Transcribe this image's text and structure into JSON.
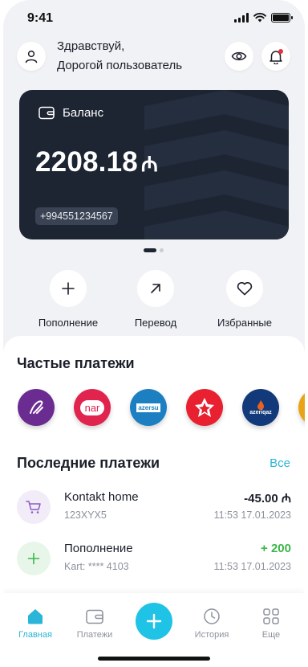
{
  "status_bar": {
    "time": "9:41"
  },
  "header": {
    "greeting_line1": "Здравствуй,",
    "greeting_line2": "Дорогой пользователь"
  },
  "balance_card": {
    "label": "Баланс",
    "amount": "2208.18",
    "currency": "₼",
    "phone": "+994551234567",
    "pager": {
      "pages": 2,
      "active": 1
    }
  },
  "actions": [
    {
      "label": "Пополнение",
      "icon": "plus-icon"
    },
    {
      "label": "Перевод",
      "icon": "arrow-up-right-icon"
    },
    {
      "label": "Избранные",
      "icon": "heart-icon"
    }
  ],
  "frequent_payments": {
    "title": "Частые платежи",
    "logos": [
      {
        "icon": "provider-logo-purple",
        "color": "#6a2c91"
      },
      {
        "icon": "provider-logo-nar",
        "text": "nar",
        "color": "#e0244e"
      },
      {
        "icon": "provider-logo-azersu",
        "text": "azersu",
        "color": "#1c7fc2"
      },
      {
        "icon": "provider-logo-red",
        "color": "#e8202f"
      },
      {
        "icon": "provider-logo-azeriqaz",
        "text": "azeriqaz",
        "color": "#123a7a"
      },
      {
        "icon": "provider-logo-partial",
        "color": "#e8a317"
      }
    ]
  },
  "recent_payments": {
    "title": "Последние платежи",
    "see_all": "Все",
    "items": [
      {
        "name": "Kontakt home",
        "sub": "123XYX5",
        "amount": "-45.00 ₼",
        "date": "11:53 17.01.2023",
        "icon": "cart-icon",
        "amount_color": "#1b1f2a"
      },
      {
        "name": "Пополнение",
        "sub": "Kart: **** 4103",
        "amount": "+ 200",
        "date": "11:53 17.01.2023",
        "icon": "plus-icon",
        "amount_color": "#3bb54a"
      }
    ]
  },
  "bottom_nav": [
    {
      "label": "Главная",
      "icon": "home-icon",
      "active": true
    },
    {
      "label": "Платежи",
      "icon": "wallet-icon",
      "active": false
    },
    {
      "label": "",
      "icon": "add-icon",
      "active": false
    },
    {
      "label": "История",
      "icon": "clock-icon",
      "active": false
    },
    {
      "label": "Еще",
      "icon": "grid-icon",
      "active": false
    }
  ],
  "colors": {
    "accent": "#1fc3e6",
    "card_background": "#1d2533",
    "positive": "#3bb54a"
  }
}
